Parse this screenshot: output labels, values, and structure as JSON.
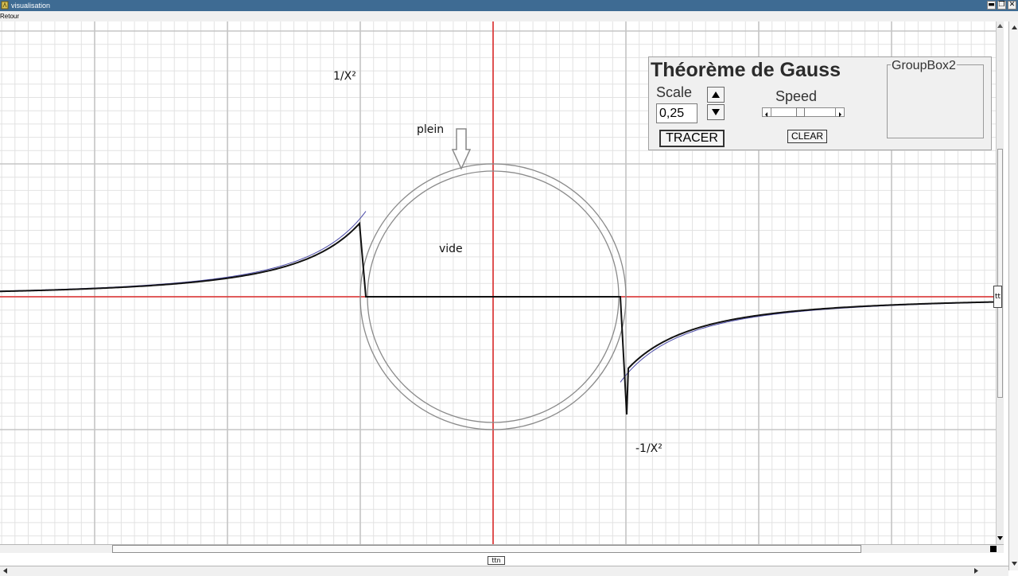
{
  "window": {
    "title": "visualisation",
    "buttons": {
      "minimize": "▬",
      "restore": "❐",
      "close": "✕"
    }
  },
  "menu": {
    "back": "Retour"
  },
  "plot": {
    "labels": {
      "inverse_square": "1/X²",
      "neg_inverse_square": "-1/X²",
      "full": "plein",
      "empty": "vide"
    },
    "colors": {
      "axis": "#e03030",
      "curve": "#4a4aa8",
      "field": "#111111",
      "sphere": "#8a8a8a",
      "grid_minor": "#e2e2e2",
      "grid_major": "#c5c5c5"
    },
    "icons": {
      "arrow": "down-arrow-icon"
    }
  },
  "panel": {
    "title": "Théorème de Gauss",
    "scale_label": "Scale",
    "scale_value": "0,25",
    "tracer_label": "TRACER",
    "speed_label": "Speed",
    "speed_level": 0.45,
    "clear_label": "CLEAR",
    "groupbox_label": "GroupBox2"
  },
  "controls": {
    "bottom_button": "ttn",
    "right_button": "tt"
  }
}
